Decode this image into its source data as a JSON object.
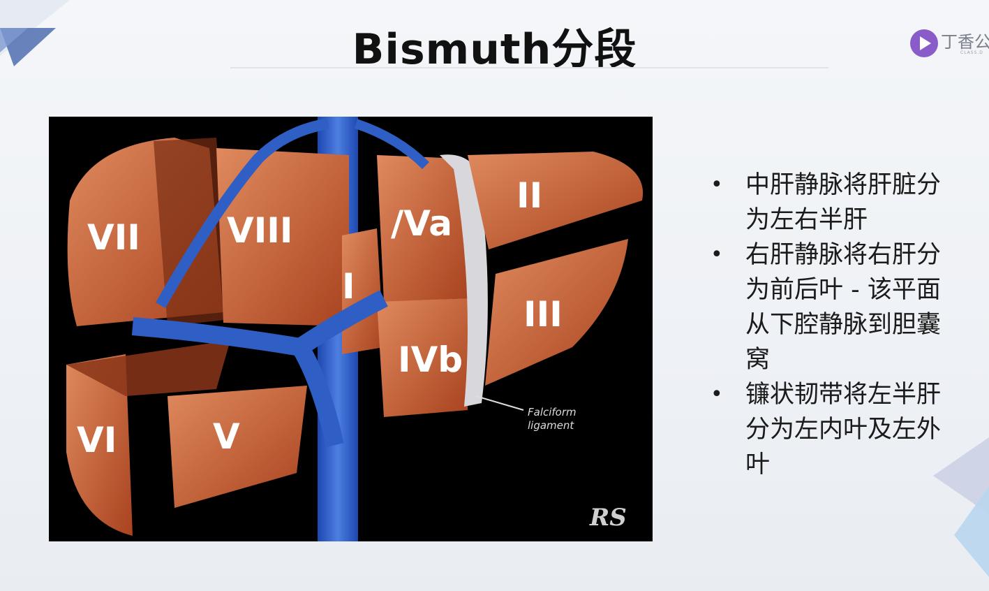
{
  "slide": {
    "title": "Bismuth分段",
    "logo_text": "丁香公",
    "logo_sub": "CLASS.D"
  },
  "figure": {
    "segments": [
      "VII",
      "VIII",
      "/Va",
      "II",
      "I",
      "III",
      "IVb",
      "VI",
      "V"
    ],
    "falciform_line1": "Falciform",
    "falciform_line2": "ligament",
    "signature": "RS"
  },
  "bullets": [
    "中肝静脉将肝脏分为左右半肝",
    "右肝静脉将右肝分为前后叶 - 该平面从下腔静脉到胆囊窝",
    "镰状韧带将左半肝分为左内叶及左外叶"
  ],
  "colors": {
    "liver": "#c8623a",
    "vein": "#2f5fc4",
    "background": "#000000"
  }
}
